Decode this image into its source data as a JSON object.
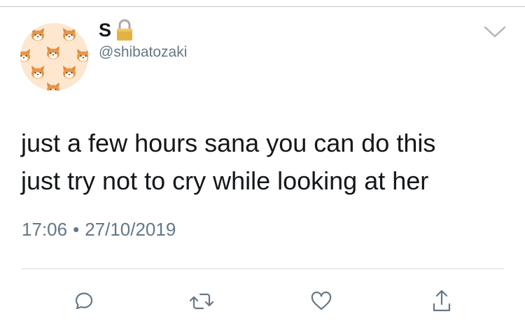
{
  "user": {
    "display_name": "S",
    "handle": "@shibatozaki",
    "protected_icon": "lock-icon",
    "avatar_pattern": "shiba-inu-faces"
  },
  "tweet": {
    "lines": [
      "just a few hours sana you can do this",
      "just try not to cry while looking at her"
    ],
    "time": "17:06",
    "separator": "•",
    "date": "27/10/2019"
  },
  "actions": [
    {
      "name": "reply",
      "icon": "reply-icon"
    },
    {
      "name": "retweet",
      "icon": "retweet-icon"
    },
    {
      "name": "like",
      "icon": "heart-icon"
    },
    {
      "name": "share",
      "icon": "share-icon"
    }
  ],
  "colors": {
    "text": "#14171a",
    "secondary": "#657786",
    "icon": "#657786",
    "avatar_bg": "#fde7cf",
    "lock": "#e3b341"
  }
}
